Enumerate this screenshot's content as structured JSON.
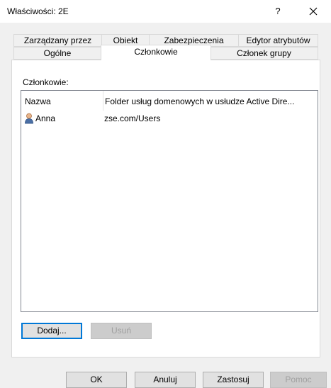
{
  "window": {
    "title": "Właściwości: 2E",
    "help_label": "?",
    "close_icon": "close-icon"
  },
  "tabs": {
    "row1": [
      "Zarządzany przez",
      "Obiekt",
      "Zabezpieczenia",
      "Edytor atrybutów"
    ],
    "row2": [
      "Ogólne",
      "Członkowie",
      "Członek grupy"
    ],
    "active": "Członkowie"
  },
  "members": {
    "label": "Członkowie:",
    "columns": [
      "Nazwa",
      "Folder usług domenowych w usłudze Active Dire..."
    ],
    "rows": [
      {
        "icon": "user-icon",
        "name": "Anna",
        "folder": "zse.com/Users"
      }
    ]
  },
  "buttons": {
    "add": "Dodaj...",
    "remove": "Usuń",
    "ok": "OK",
    "cancel": "Anuluj",
    "apply": "Zastosuj",
    "help": "Pomoc"
  },
  "colors": {
    "background": "#f0f0f0",
    "panel": "#ffffff",
    "focus_border": "#0078d7"
  }
}
